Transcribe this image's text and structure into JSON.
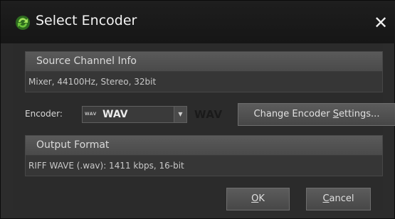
{
  "window": {
    "title": "Select Encoder",
    "icon": "refresh-arrows-icon",
    "close_glyph": "✕"
  },
  "source_section": {
    "header": "Source Channel Info",
    "value": "Mixer, 44100Hz, Stereo, 32bit"
  },
  "encoder": {
    "label": "Encoder:",
    "selected": "WAV",
    "mini_logo": "WAV",
    "logo": "WAV",
    "change_button_pre": "Change Encoder ",
    "change_button_mnemonic": "S",
    "change_button_post": "ettings..."
  },
  "output_section": {
    "header": "Output Format",
    "value": "RIFF WAVE (.wav): 1411 kbps, 16-bit"
  },
  "buttons": {
    "ok_mnemonic": "O",
    "ok_rest": "K",
    "cancel_mnemonic": "C",
    "cancel_rest": "ancel"
  },
  "colors": {
    "titlebar": "#1a1a1a",
    "client_background": "#2b2b2b",
    "section_header": "#525252",
    "icon_green": "#4caf3a"
  }
}
